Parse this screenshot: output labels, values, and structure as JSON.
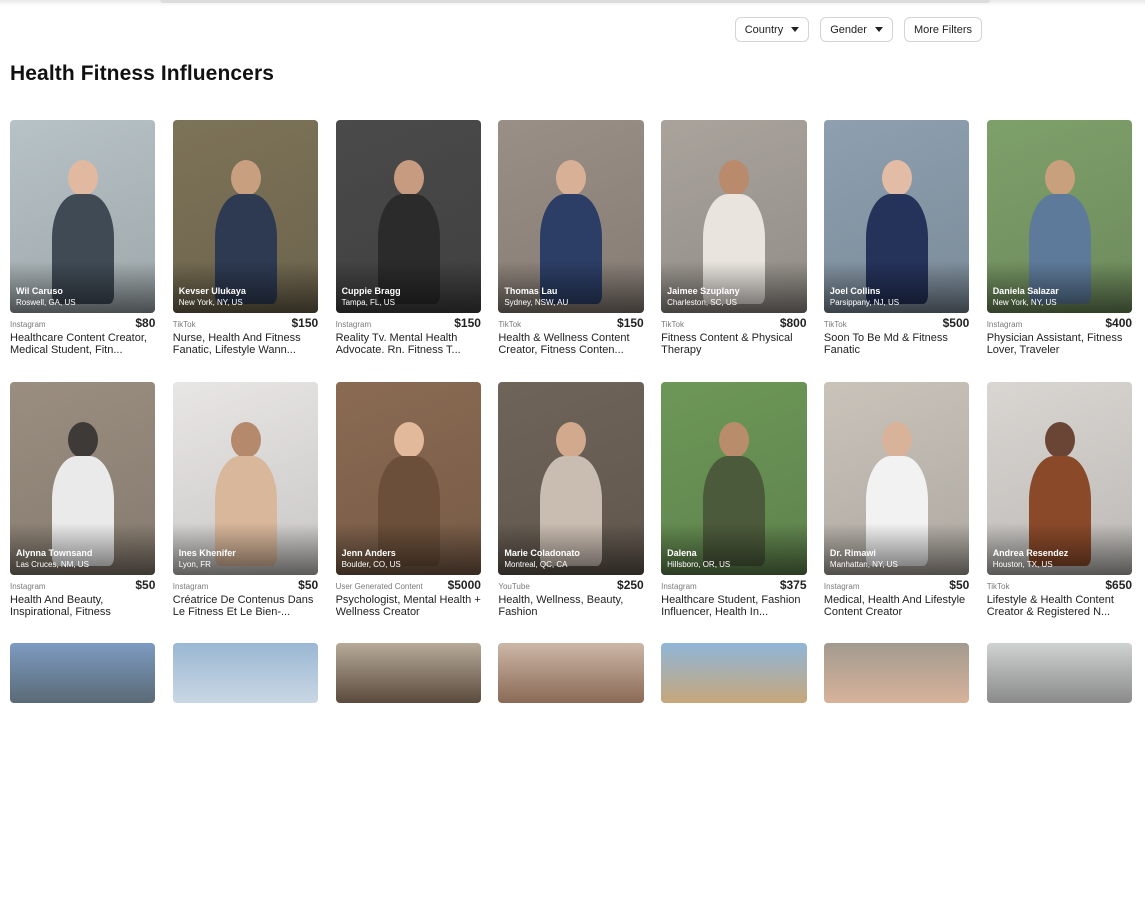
{
  "filters": [
    {
      "label": "Country",
      "icon": "chevron-down-icon"
    },
    {
      "label": "Gender",
      "icon": "chevron-down-icon"
    },
    {
      "label": "More Filters"
    }
  ],
  "page": {
    "title": "Health Fitness Influencers"
  },
  "influencers": [
    {
      "name": "Wil Caruso",
      "location": "Roswell, GA, US",
      "platform": "Instagram",
      "price": "$80",
      "desc": "Healthcare Content Creator, Medical Student, Fitn...",
      "photo": {
        "bg": "#b7c2c6",
        "accent": "#3f4a55",
        "skin": "#e0b9a0"
      }
    },
    {
      "name": "Kevser Ulukaya",
      "location": "New York, NY, US",
      "platform": "TikTok",
      "price": "$150",
      "desc": "Nurse, Health And Fitness Fanatic, Lifestyle Wann...",
      "photo": {
        "bg": "#7d7358",
        "accent": "#2e3a52",
        "skin": "#c8a080"
      }
    },
    {
      "name": "Cuppie Bragg",
      "location": "Tampa, FL, US",
      "platform": "Instagram",
      "price": "$150",
      "desc": "Reality Tv. Mental Health Advocate. Rn. Fitness T...",
      "photo": {
        "bg": "#4a4a4a",
        "accent": "#2b2b2b",
        "skin": "#c79b80"
      }
    },
    {
      "name": "Thomas Lau",
      "location": "Sydney, NSW, AU",
      "platform": "TikTok",
      "price": "$150",
      "desc": "Health & Wellness Content Creator, Fitness Conten...",
      "photo": {
        "bg": "#9a8f86",
        "accent": "#2c3e66",
        "skin": "#d8b095"
      }
    },
    {
      "name": "Jaimee Szuplany",
      "location": "Charleston, SC, US",
      "platform": "TikTok",
      "price": "$800",
      "desc": "Fitness Content & Physical Therapy",
      "photo": {
        "bg": "#a9a39c",
        "accent": "#e9e4de",
        "skin": "#b98a6b"
      }
    },
    {
      "name": "Joel Collins",
      "location": "Parsippany, NJ, US",
      "platform": "TikTok",
      "price": "$500",
      "desc": "Soon To Be Md & Fitness Fanatic",
      "photo": {
        "bg": "#8ea0b0",
        "accent": "#25325a",
        "skin": "#e2bca5"
      }
    },
    {
      "name": "Daniela Salazar",
      "location": "New York, NY, US",
      "platform": "Instagram",
      "price": "$400",
      "desc": "Physician Assistant, Fitness Lover, Traveler",
      "photo": {
        "bg": "#7ea06a",
        "accent": "#5d7a9a",
        "skin": "#c9a07d"
      }
    },
    {
      "name": "Alynna Townsand",
      "location": "Las Cruces, NM, US",
      "platform": "Instagram",
      "price": "$50",
      "desc": "Health And Beauty, Inspirational, Fitness",
      "photo": {
        "bg": "#9a8e80",
        "accent": "#eaeaea",
        "skin": "#3d3a38"
      }
    },
    {
      "name": "Ines Khenifer",
      "location": "Lyon, FR",
      "platform": "Instagram",
      "price": "$50",
      "desc": "Créatrice De Contenus Dans Le Fitness Et Le Bien-...",
      "photo": {
        "bg": "#e8e6e4",
        "accent": "#d8b79a",
        "skin": "#b5896b"
      }
    },
    {
      "name": "Jenn Anders",
      "location": "Boulder, CO, US",
      "platform": "User Generated Content",
      "price": "$5000",
      "desc": "Psychologist, Mental Health + Wellness Creator",
      "photo": {
        "bg": "#8a6a52",
        "accent": "#6b4f3a",
        "skin": "#e2b99a"
      }
    },
    {
      "name": "Marie Coladonato",
      "location": "Montreal, QC, CA",
      "platform": "YouTube",
      "price": "$250",
      "desc": "Health, Wellness, Beauty, Fashion",
      "photo": {
        "bg": "#6f6459",
        "accent": "#c9bdb1",
        "skin": "#d2a98d"
      }
    },
    {
      "name": "Dalena",
      "location": "Hillsboro, OR, US",
      "platform": "Instagram",
      "price": "$375",
      "desc": "Healthcare Student, Fashion Influencer, Health In...",
      "photo": {
        "bg": "#6d9758",
        "accent": "#4b5a3a",
        "skin": "#b98d6c"
      }
    },
    {
      "name": "Dr. Rimawi",
      "location": "Manhattan, NY, US",
      "platform": "Instagram",
      "price": "$50",
      "desc": "Medical, Health And Lifestyle Content Creator",
      "photo": {
        "bg": "#c9c3ba",
        "accent": "#f2f2f2",
        "skin": "#d8b39a"
      }
    },
    {
      "name": "Andrea Resendez",
      "location": "Houston, TX, US",
      "platform": "TikTok",
      "price": "$650",
      "desc": "Lifestyle & Health Content Creator & Registered N...",
      "photo": {
        "bg": "#d9d6d2",
        "accent": "#8a4a2a",
        "skin": "#6a4535"
      }
    }
  ],
  "next_row_photos": [
    {
      "bg": "#7d9bc2",
      "accent": "#5a6a75"
    },
    {
      "bg": "#9ab7d3",
      "accent": "#c9d7e3"
    },
    {
      "bg": "#b7aa98",
      "accent": "#5b4b3e"
    },
    {
      "bg": "#ccb7a7",
      "accent": "#8a6a55"
    },
    {
      "bg": "#8fb6d8",
      "accent": "#c7a77a"
    },
    {
      "bg": "#a29a8f",
      "accent": "#d8b39a"
    },
    {
      "bg": "#cfd3d2",
      "accent": "#8a8a8a"
    }
  ]
}
